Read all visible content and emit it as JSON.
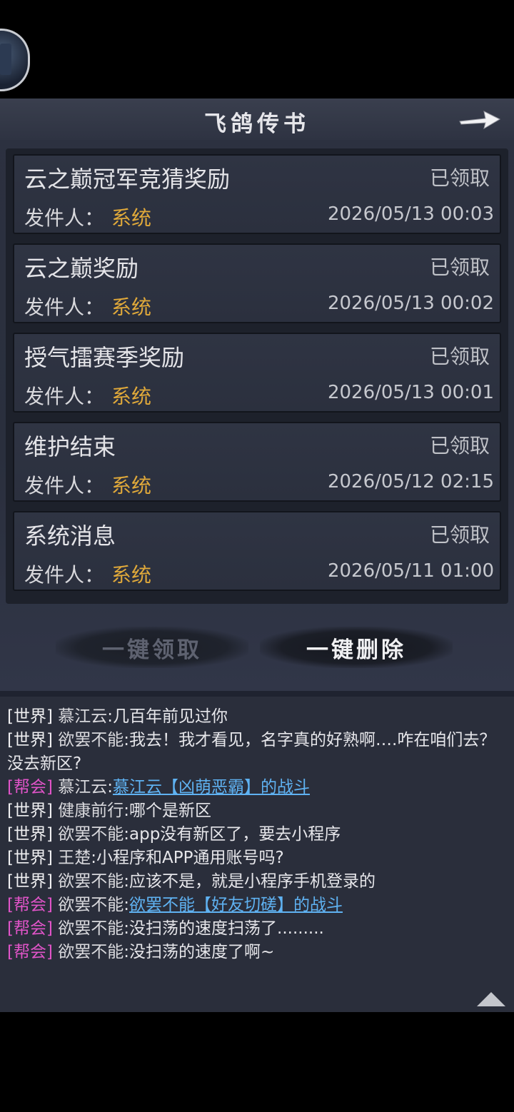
{
  "header": {
    "title": "飞鸽传书"
  },
  "mails": [
    {
      "title": "云之巅冠军竞猜奖励",
      "status": "已领取",
      "sender_label": "发件人：",
      "sender": "系统",
      "time": "2026/05/13 00:03"
    },
    {
      "title": "云之巅奖励",
      "status": "已领取",
      "sender_label": "发件人：",
      "sender": "系统",
      "time": "2026/05/13 00:02"
    },
    {
      "title": "授气擂赛季奖励",
      "status": "已领取",
      "sender_label": "发件人：",
      "sender": "系统",
      "time": "2026/05/13 00:01"
    },
    {
      "title": "维护结束",
      "status": "已领取",
      "sender_label": "发件人：",
      "sender": "系统",
      "time": "2026/05/12 02:15"
    },
    {
      "title": "系统消息",
      "status": "已领取",
      "sender_label": "发件人：",
      "sender": "系统",
      "time": "2026/05/11 01:00"
    }
  ],
  "actions": {
    "claim_all": "一键领取",
    "delete_all": "一键删除"
  },
  "chat": [
    {
      "channel": "[世界]",
      "name": "慕江云",
      "text": ":几百年前见过你",
      "link": ""
    },
    {
      "channel": "[世界]",
      "name": "欲罢不能",
      "text": ":我去！我才看见，名字真的好熟啊….咋在咱们去？没去新区?",
      "link": ""
    },
    {
      "channel": "[帮会]",
      "name": "慕江云",
      "text": ":",
      "link": "慕江云【凶萌恶霸】的战斗"
    },
    {
      "channel": "[世界]",
      "name": "健康前行",
      "text": ":哪个是新区",
      "link": ""
    },
    {
      "channel": "[世界]",
      "name": "欲罢不能",
      "text": ":app没有新区了，要去小程序",
      "link": ""
    },
    {
      "channel": "[世界]",
      "name": "王楚",
      "text": ":小程序和APP通用账号吗?",
      "link": ""
    },
    {
      "channel": "[世界]",
      "name": "欲罢不能",
      "text": ":应该不是，就是小程序手机登录的",
      "link": ""
    },
    {
      "channel": "[帮会]",
      "name": "欲罢不能",
      "text": ":",
      "link": "欲罢不能【好友切磋】的战斗"
    },
    {
      "channel": "[帮会]",
      "name": "欲罢不能",
      "text": ":没扫荡的速度扫荡了.........",
      "link": ""
    },
    {
      "channel": "[帮会]",
      "name": "欲罢不能",
      "text": ":没扫荡的速度了啊~",
      "link": ""
    }
  ],
  "colors": {
    "sender": "#e0a93a",
    "guild_channel": "#e054c8",
    "link": "#5fb2f2"
  },
  "icons": {
    "back": "arrow-right-icon",
    "scroll": "triangle-up-icon",
    "avatar": "player-avatar"
  }
}
